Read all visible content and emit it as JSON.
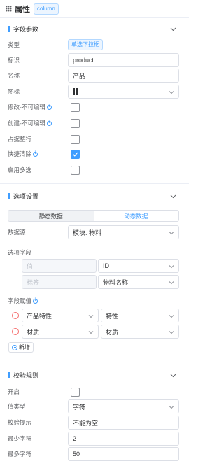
{
  "header": {
    "title": "属性",
    "tag": "column"
  },
  "field_params": {
    "title": "字段参数",
    "type": {
      "label": "类型",
      "value": "单选下拉框"
    },
    "identifier": {
      "label": "标识",
      "value": "product"
    },
    "name": {
      "label": "名称",
      "value": "产品"
    },
    "icon": {
      "label": "图标"
    },
    "modify_readonly": {
      "label": "修改-不可编辑",
      "checked": false
    },
    "create_readonly": {
      "label": "创建-不可编辑",
      "checked": false
    },
    "full_row": {
      "label": "占据整行",
      "checked": false
    },
    "quick_clear": {
      "label": "快捷清除",
      "checked": true
    },
    "multi_select": {
      "label": "启用多选",
      "checked": false
    }
  },
  "options": {
    "title": "选项设置",
    "tabs": [
      "静态数据",
      "动态数据"
    ],
    "datasource": {
      "label": "数据源",
      "value": "模块: 物料"
    },
    "option_fields": {
      "label": "选项字段",
      "rows": [
        {
          "key": "值",
          "value": "ID"
        },
        {
          "key": "标签",
          "value": "物料名称"
        }
      ]
    },
    "field_assign": {
      "label": "字段赋值",
      "rows": [
        {
          "source": "产品特性",
          "target": "特性"
        },
        {
          "source": "材质",
          "target": "材质"
        }
      ]
    },
    "add_label": "新增"
  },
  "validation": {
    "title": "校验规则",
    "enabled": {
      "label": "开启",
      "checked": false
    },
    "value_type": {
      "label": "值类型",
      "value": "字符"
    },
    "hint": {
      "label": "校验提示",
      "value": "不能为空"
    },
    "min_chars": {
      "label": "最少字符",
      "value": "2"
    },
    "max_chars": {
      "label": "最多字符",
      "value": "50"
    }
  },
  "colors": {
    "accent": "#409eff",
    "danger": "#f56c6c",
    "border": "#dcdfe6"
  }
}
